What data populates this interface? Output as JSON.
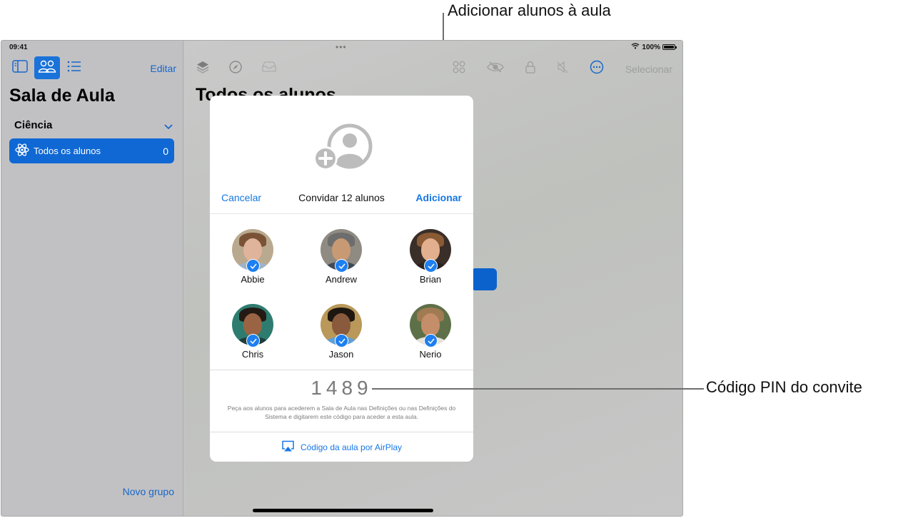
{
  "status_bar": {
    "time": "09:41",
    "battery": "100%",
    "icons": [
      "wifi-icon",
      "battery-icon"
    ]
  },
  "sidebar": {
    "toolbar": {
      "icons": [
        "sidebar-toggle-icon",
        "people-icon",
        "list-icon"
      ],
      "active_index": 1,
      "edit_label": "Editar"
    },
    "title": "Sala de Aula",
    "section": {
      "label": "Ciência",
      "expanded": true
    },
    "items": [
      {
        "label": "Todos os alunos",
        "count": "0",
        "icon": "atom-icon",
        "selected": true
      }
    ],
    "new_group_label": "Novo grupo"
  },
  "main": {
    "title": "Todos os alunos",
    "toolbar_left_icons": [
      "layers-icon",
      "compass-icon",
      "tray-icon"
    ],
    "toolbar_right_icons": [
      "apps-grid-icon",
      "eye-slash-icon",
      "lock-icon",
      "mute-icon",
      "more-icon"
    ],
    "select_label": "Selecionar"
  },
  "modal": {
    "hero_icon": "add-person-icon",
    "cancel_label": "Cancelar",
    "title": "Convidar 12 alunos",
    "add_label": "Adicionar",
    "students": [
      {
        "name": "Abbie",
        "selected": true,
        "skin": "#e0b49a",
        "hair": "#7a5236",
        "shirt": "#9fb3c8",
        "bg": "#b9a98e"
      },
      {
        "name": "Andrew",
        "selected": true,
        "skin": "#c89a73",
        "hair": "#6d6d6d",
        "shirt": "#3e4a5a",
        "bg": "#8f8a82"
      },
      {
        "name": "Brian",
        "selected": true,
        "skin": "#e2b08f",
        "hair": "#8a5a34",
        "shirt": "#2a2420",
        "bg": "#3a2e28"
      },
      {
        "name": "Chris",
        "selected": true,
        "skin": "#9a6444",
        "hair": "#241a14",
        "shirt": "#1f3d3a",
        "bg": "#2e7c70"
      },
      {
        "name": "Jason",
        "selected": true,
        "skin": "#8a5a3c",
        "hair": "#1e1610",
        "shirt": "#5fa0d8",
        "bg": "#b9985a"
      },
      {
        "name": "Nerio",
        "selected": true,
        "skin": "#c48e6a",
        "hair": "#a07a52",
        "shirt": "#e8e2da",
        "bg": "#5e7048"
      }
    ],
    "pin": "1489",
    "pin_hint": "Peça aos alunos para acederem a Sala de Aula nas Definições ou nas Definições do Sistema e digitarem este código para aceder a esta aula.",
    "airplay_label": "Código da aula por AirPlay"
  },
  "callouts": {
    "add_students": "Adicionar alunos à aula",
    "pin_code": "Código PIN do convite"
  },
  "colors": {
    "accent": "#1677e6",
    "selection": "#0f68d4",
    "check": "#1d7ff0"
  }
}
